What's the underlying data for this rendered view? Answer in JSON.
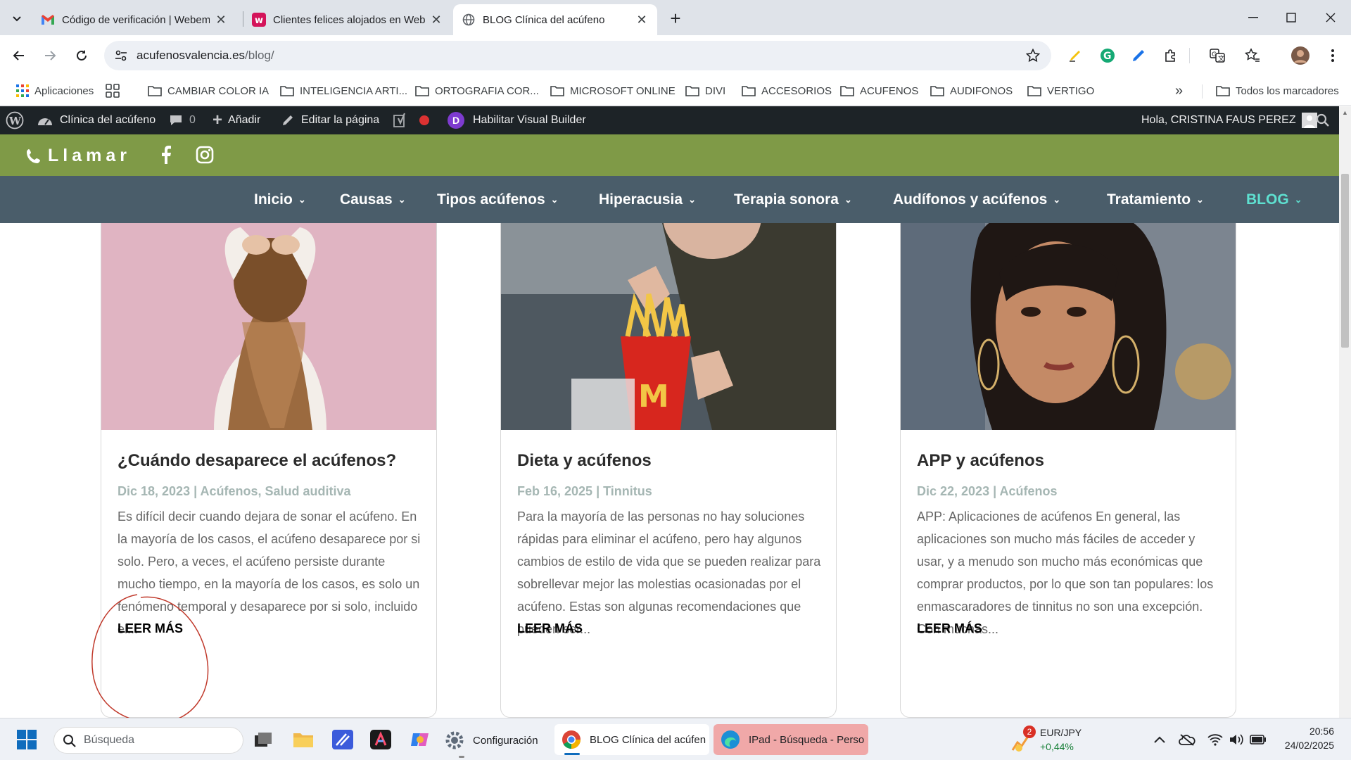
{
  "browser": {
    "tabs": [
      {
        "title": "Código de verificación | Webem"
      },
      {
        "title": "Clientes felices alojados en Web"
      },
      {
        "title": "BLOG Clínica del acúfeno"
      }
    ],
    "url_domain": "acufenosvalencia.es",
    "url_path": "/blog/",
    "bookmarks": [
      "Aplicaciones",
      "CAMBIAR COLOR IA",
      "INTELIGENCIA ARTI...",
      "ORTOGRAFIA COR...",
      "MICROSOFT ONLINE",
      "DIVI",
      "ACCESORIOS",
      "ACUFENOS",
      "AUDIFONOS",
      "VERTIGO"
    ],
    "all_bookmarks": "Todos los marcadores",
    "overflow_label": "»"
  },
  "wpbar": {
    "site": "Clínica del acúfeno",
    "comments": "0",
    "add": "Añadir",
    "edit": "Editar la página",
    "divi_letter": "D",
    "visual_builder": "Habilitar Visual Builder",
    "greeting": "Hola, CRISTINA FAUS PEREZ"
  },
  "topbar": {
    "call": "Llamar"
  },
  "nav": {
    "items": [
      "Inicio",
      "Causas",
      "Tipos acúfenos",
      "Hiperacusia",
      "Terapia sonora",
      "Audífonos y acúfenos",
      "Tratamiento",
      "BLOG"
    ],
    "active_color": "#5ee0d0"
  },
  "posts": [
    {
      "title": "¿Cuándo desaparece el acúfenos?",
      "meta": "Dic 18, 2023 | Acúfenos, Salud auditiva",
      "excerpt": "Es difícil decir cuando dejara de sonar el acúfeno. En la mayoría de los casos, el acúfeno desaparece por si solo. Pero, a veces, el acúfeno persiste durante mucho tiempo, en la mayoría de los casos, es solo un fenómeno temporal y desaparece por si solo, incluido el...",
      "more": "LEER MÁS"
    },
    {
      "title": "Dieta y acúfenos",
      "meta": "Feb 16, 2025 | Tinnitus",
      "excerpt": "Para la mayoría de las personas no hay soluciones rápidas para eliminar el acúfeno, pero hay algunos cambios de estilo de vida que se pueden realizar para sobrellevar mejor las molestias ocasionadas por el acúfeno. Estas son algunas recomendaciones que pueden ser...",
      "more": "LEER MÁS"
    },
    {
      "title": "APP y acúfenos",
      "meta": "Dic 22, 2023 | Acúfenos",
      "excerpt": "APP: Aplicaciones de acúfenos En general, las aplicaciones son mucho más fáciles de acceder y usar, y a menudo son mucho más económicas que comprar productos, por lo que son tan populares: los enmascaradores de tinnitus no son una excepción. Con muchas...",
      "more": "LEER MÁS"
    }
  ],
  "taskbar": {
    "search_placeholder": "Búsqueda",
    "settings": "Configuración",
    "chrome_window": "BLOG Clínica del acúfen",
    "edge_window": "IPad - Búsqueda - Perso",
    "widget_badge": "2",
    "widget_title": "EUR/JPY",
    "widget_value": "+0,44%",
    "time": "20:56",
    "date": "24/02/2025"
  }
}
